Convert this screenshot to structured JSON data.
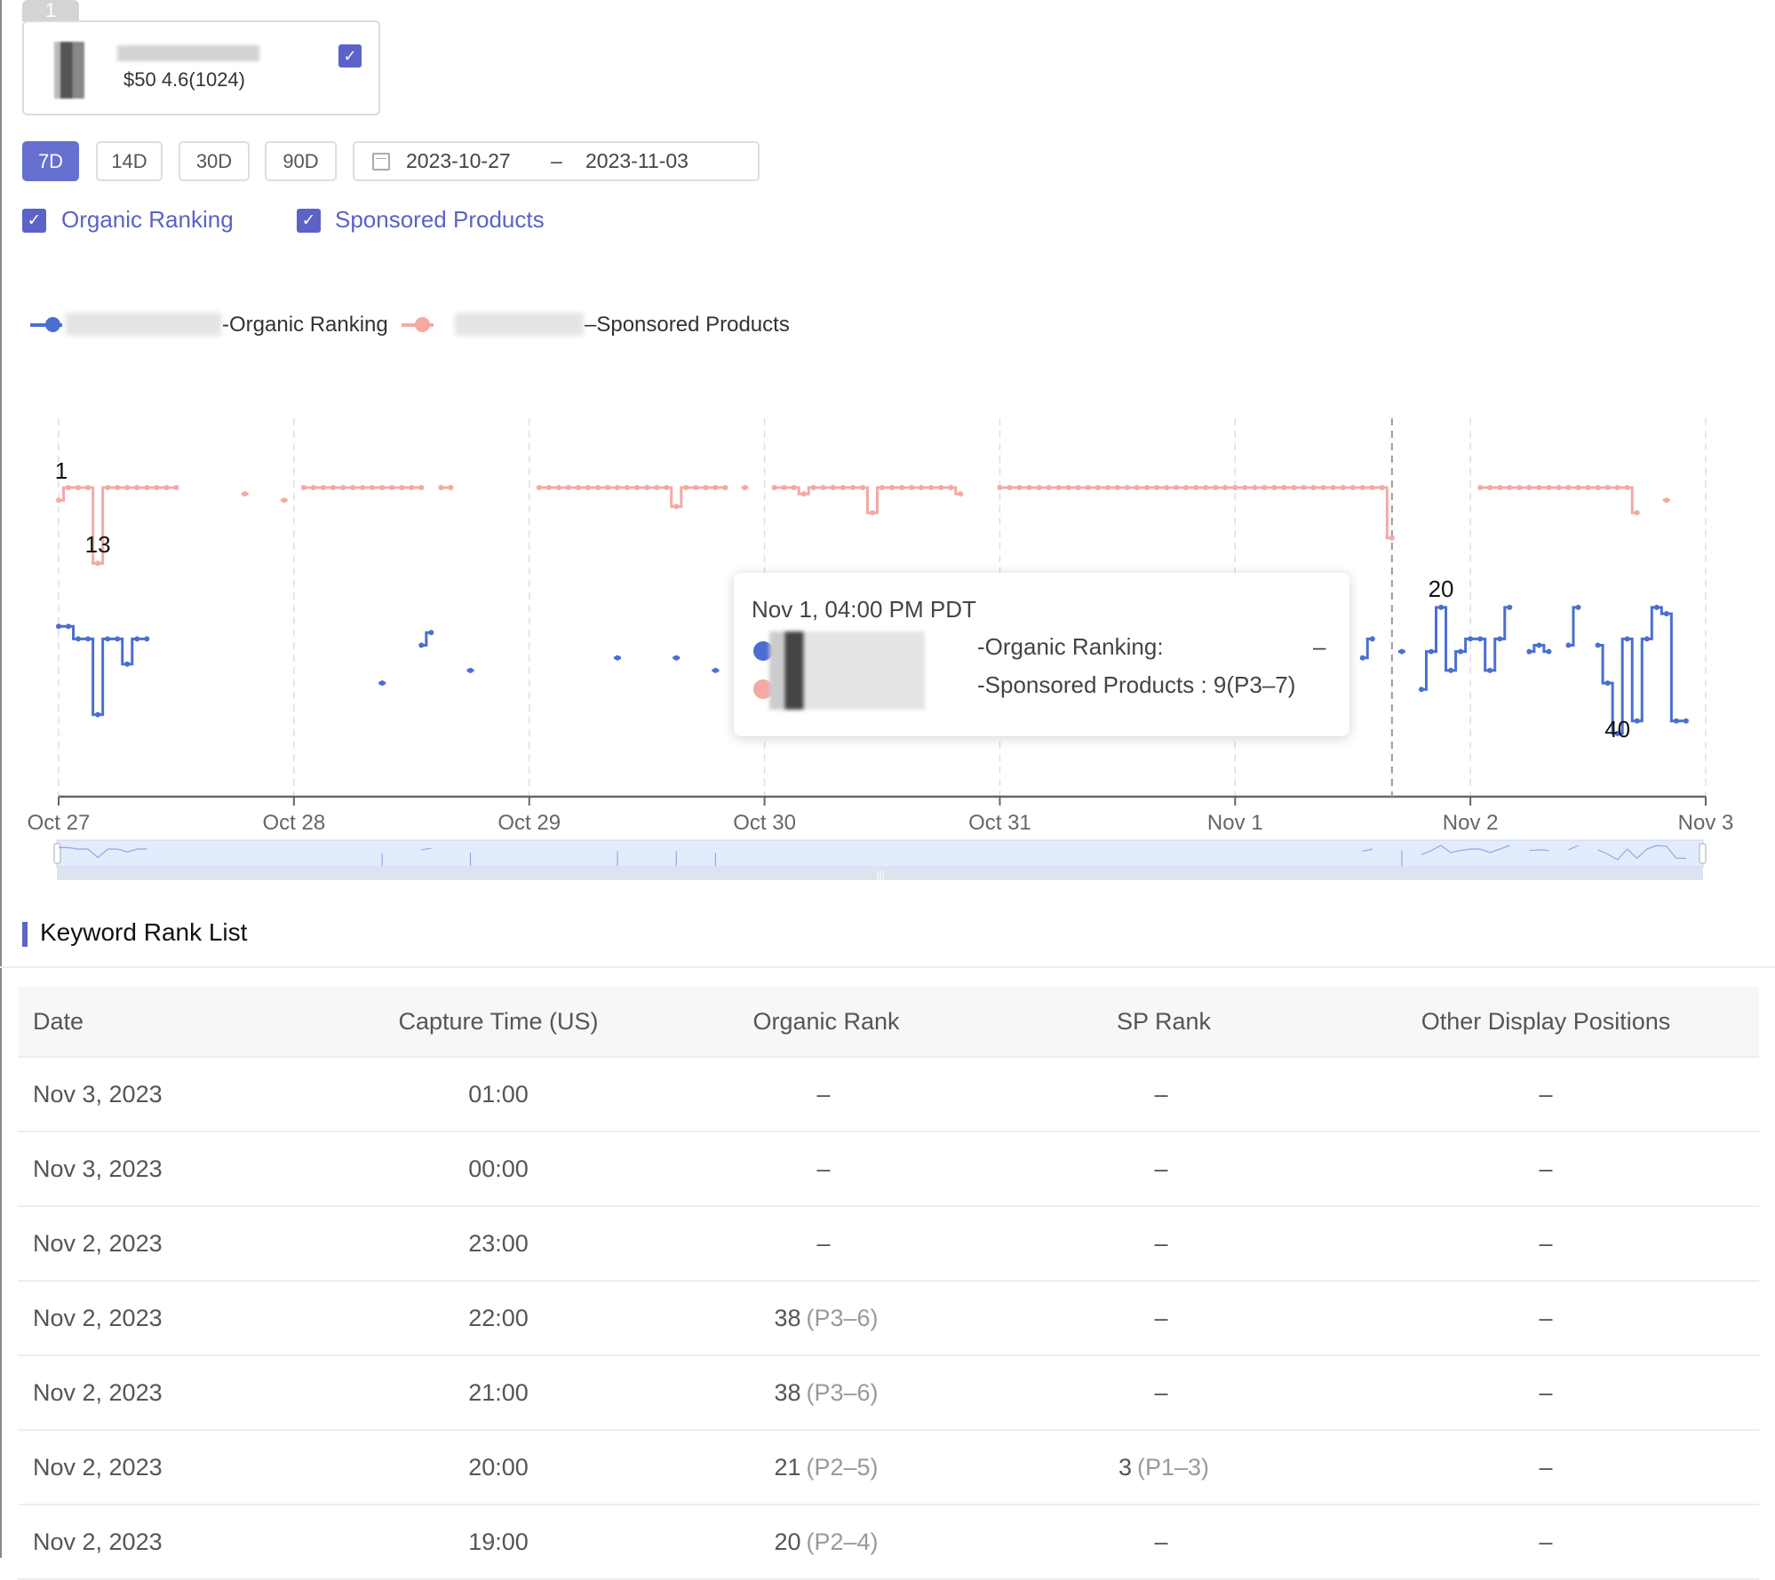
{
  "product_card": {
    "tab_label": "1",
    "price_rating": "$50 4.6(1024)",
    "selected": true
  },
  "range_buttons": [
    {
      "label": "7D",
      "active": true
    },
    {
      "label": "14D",
      "active": false
    },
    {
      "label": "30D",
      "active": false
    },
    {
      "label": "90D",
      "active": false
    }
  ],
  "date_range": {
    "start": "2023-10-27",
    "separator": "–",
    "end": "2023-11-03",
    "icon": "calendar-icon"
  },
  "filters": [
    {
      "label": "Organic Ranking",
      "checked": true
    },
    {
      "label": "Sponsored Products",
      "checked": true
    }
  ],
  "colors": {
    "accent": "#5b62c8",
    "organic": "#4a6fcf",
    "sponsored": "#f4a9a3"
  },
  "chart_data": {
    "type": "line",
    "step": true,
    "y_inverted": true,
    "legend": [
      "-Organic Ranking",
      "–Sponsored Products"
    ],
    "legend_placement": "top-left",
    "x_ticks": [
      "Oct 27",
      "Oct 28",
      "Oct 29",
      "Oct 30",
      "Oct 31",
      "Nov 1",
      "Nov 2",
      "Nov 3"
    ],
    "x_range": [
      "2023-10-27 00:00",
      "2023-11-03 00:00"
    ],
    "grid": "vertical dashed",
    "series": [
      {
        "name": "-Organic Ranking",
        "color": "#4a6fcf",
        "runs": [
          {
            "start": "2023-10-27 00:00",
            "values": [
              23,
              23,
              25,
              25,
              37,
              25,
              25,
              29,
              25,
              25
            ]
          },
          {
            "start": "2023-10-28 09:00",
            "values": [
              32
            ]
          },
          {
            "start": "2023-10-28 13:00",
            "values": [
              26,
              24
            ]
          },
          {
            "start": "2023-10-28 18:00",
            "values": [
              30
            ]
          },
          {
            "start": "2023-10-29 09:00",
            "values": [
              28
            ]
          },
          {
            "start": "2023-10-29 15:00",
            "values": [
              28
            ]
          },
          {
            "start": "2023-10-29 19:00",
            "values": [
              30
            ]
          },
          {
            "start": "2023-11-01 13:00",
            "values": [
              28,
              25
            ]
          },
          {
            "start": "2023-11-01 17:00",
            "values": [
              27
            ]
          },
          {
            "start": "2023-11-01 19:00",
            "values": [
              33,
              27,
              20,
              30,
              27,
              25,
              25,
              30,
              25,
              20
            ]
          },
          {
            "start": "2023-11-02 06:00",
            "values": [
              27,
              26,
              27
            ]
          },
          {
            "start": "2023-11-02 10:00",
            "values": [
              26,
              20
            ]
          },
          {
            "start": "2023-11-02 13:00",
            "values": [
              26,
              32,
              40,
              25,
              38,
              25,
              20,
              21,
              38,
              38
            ]
          }
        ]
      },
      {
        "name": "–Sponsored Products",
        "color": "#f4a9a3",
        "runs": [
          {
            "start": "2023-10-27 00:00",
            "values": [
              3,
              1,
              1,
              1,
              13,
              1,
              1,
              1,
              1,
              1,
              1,
              1,
              1
            ]
          },
          {
            "start": "2023-10-27 19:00",
            "values": [
              2
            ]
          },
          {
            "start": "2023-10-27 23:00",
            "values": [
              3
            ]
          },
          {
            "start": "2023-10-28 01:00",
            "values": [
              1,
              1,
              1,
              1,
              1,
              1,
              1,
              1,
              1,
              1,
              1,
              1,
              1
            ]
          },
          {
            "start": "2023-10-28 15:00",
            "values": [
              1,
              1
            ]
          },
          {
            "start": "2023-10-29 01:00",
            "values": [
              1,
              1,
              1,
              1,
              1,
              1,
              1,
              1,
              1,
              1,
              1,
              1,
              1,
              1,
              4,
              1,
              1,
              1,
              1,
              1
            ]
          },
          {
            "start": "2023-10-29 22:00",
            "values": [
              1
            ]
          },
          {
            "start": "2023-10-30 01:00",
            "values": [
              1,
              1,
              1,
              2,
              1,
              1,
              1,
              1,
              1,
              1,
              5,
              1,
              1,
              1,
              1,
              1,
              1,
              1,
              1,
              2
            ]
          },
          {
            "start": "2023-10-31 00:00",
            "values": [
              1,
              1,
              1,
              1,
              1,
              1,
              1,
              1,
              1,
              1,
              1,
              1,
              1,
              1,
              1,
              1,
              1,
              1,
              1,
              1,
              1,
              1,
              1,
              1,
              1,
              1,
              1,
              1,
              1,
              1,
              1,
              1,
              1,
              1,
              1,
              1,
              1,
              1,
              1,
              1,
              9
            ]
          },
          {
            "start": "2023-11-02 01:00",
            "values": [
              1,
              1,
              1,
              1,
              1,
              1,
              1,
              1,
              1,
              1,
              1,
              1,
              1,
              1,
              1,
              1,
              5
            ]
          },
          {
            "start": "2023-11-02 20:00",
            "values": [
              3
            ]
          }
        ]
      }
    ],
    "annotations": [
      {
        "text": "1",
        "series": "sponsored",
        "at": "2023-10-27 01:00",
        "value": 1
      },
      {
        "text": "13",
        "series": "sponsored",
        "at": "2023-10-27 04:00",
        "value": 13
      },
      {
        "text": "20",
        "series": "organic",
        "at": "2023-11-01 21:00",
        "value": 20
      },
      {
        "text": "40",
        "series": "organic",
        "at": "2023-11-02 15:00",
        "value": 40
      }
    ],
    "hover_at": "2023-11-01 16:00"
  },
  "tooltip": {
    "title": "Nov 1, 04:00 PM PDT",
    "rows": [
      {
        "label": "-Organic Ranking:",
        "value": "–"
      },
      {
        "label": "-Sponsored Products : 9(P3–7)",
        "value": ""
      }
    ]
  },
  "keyword_list": {
    "title": "Keyword Rank List",
    "columns": [
      "Date",
      "Capture Time (US)",
      "Organic Rank",
      "SP Rank",
      "Other Display Positions"
    ],
    "rows": [
      {
        "date": "Nov 3, 2023",
        "time": "01:00",
        "organic": {
          "rank": "–",
          "range": ""
        },
        "sp": {
          "rank": "–",
          "range": ""
        },
        "other": "–"
      },
      {
        "date": "Nov 3, 2023",
        "time": "00:00",
        "organic": {
          "rank": "–",
          "range": ""
        },
        "sp": {
          "rank": "–",
          "range": ""
        },
        "other": "–"
      },
      {
        "date": "Nov 2, 2023",
        "time": "23:00",
        "organic": {
          "rank": "–",
          "range": ""
        },
        "sp": {
          "rank": "–",
          "range": ""
        },
        "other": "–"
      },
      {
        "date": "Nov 2, 2023",
        "time": "22:00",
        "organic": {
          "rank": "38",
          "range": "(P3–6)"
        },
        "sp": {
          "rank": "–",
          "range": ""
        },
        "other": "–"
      },
      {
        "date": "Nov 2, 2023",
        "time": "21:00",
        "organic": {
          "rank": "38",
          "range": "(P3–6)"
        },
        "sp": {
          "rank": "–",
          "range": ""
        },
        "other": "–"
      },
      {
        "date": "Nov 2, 2023",
        "time": "20:00",
        "organic": {
          "rank": "21",
          "range": "(P2–5)"
        },
        "sp": {
          "rank": "3",
          "range": "(P1–3)"
        },
        "other": "–"
      },
      {
        "date": "Nov 2, 2023",
        "time": "19:00",
        "organic": {
          "rank": "20",
          "range": "(P2–4)"
        },
        "sp": {
          "rank": "–",
          "range": ""
        },
        "other": "–"
      }
    ]
  }
}
